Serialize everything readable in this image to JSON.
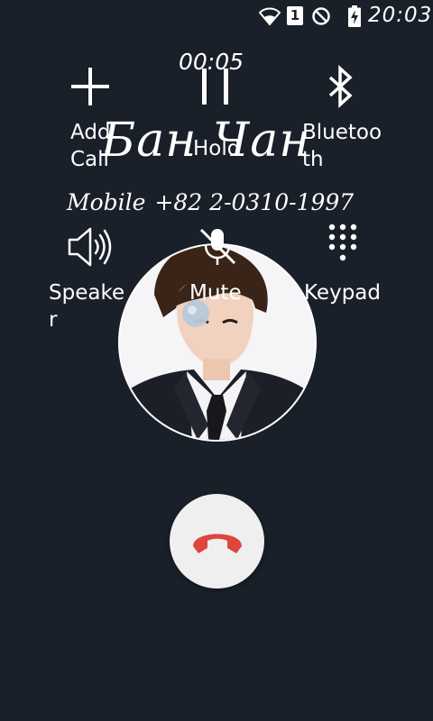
{
  "status_bar": {
    "sim_slot": "1",
    "time": "20:03",
    "icons": [
      "wifi-icon",
      "sim-badge",
      "do-not-disturb-icon",
      "battery-charging-icon"
    ]
  },
  "call": {
    "timer": "00:05",
    "contact_name": "Бан Чан",
    "number_type": "Mobile",
    "number": "+82 2-0310-1997"
  },
  "controls": {
    "add_call": {
      "label": "Add Call",
      "icon": "plus-icon"
    },
    "hold": {
      "label": "Hold",
      "icon": "pause-icon"
    },
    "bluetooth": {
      "label": "Bluetooth",
      "icon": "bluetooth-icon"
    },
    "speaker": {
      "label": "Speaker",
      "icon": "speaker-icon"
    },
    "mute": {
      "label": "Mute",
      "icon": "mic-off-icon"
    },
    "keypad": {
      "label": "Keypad",
      "icon": "dialpad-icon"
    }
  },
  "end_call": {
    "icon": "hang-up-icon"
  },
  "colors": {
    "background": "#1a202a",
    "end_call_bg": "#efefef",
    "end_call_icon": "#e0443e",
    "text": "#ffffff"
  }
}
